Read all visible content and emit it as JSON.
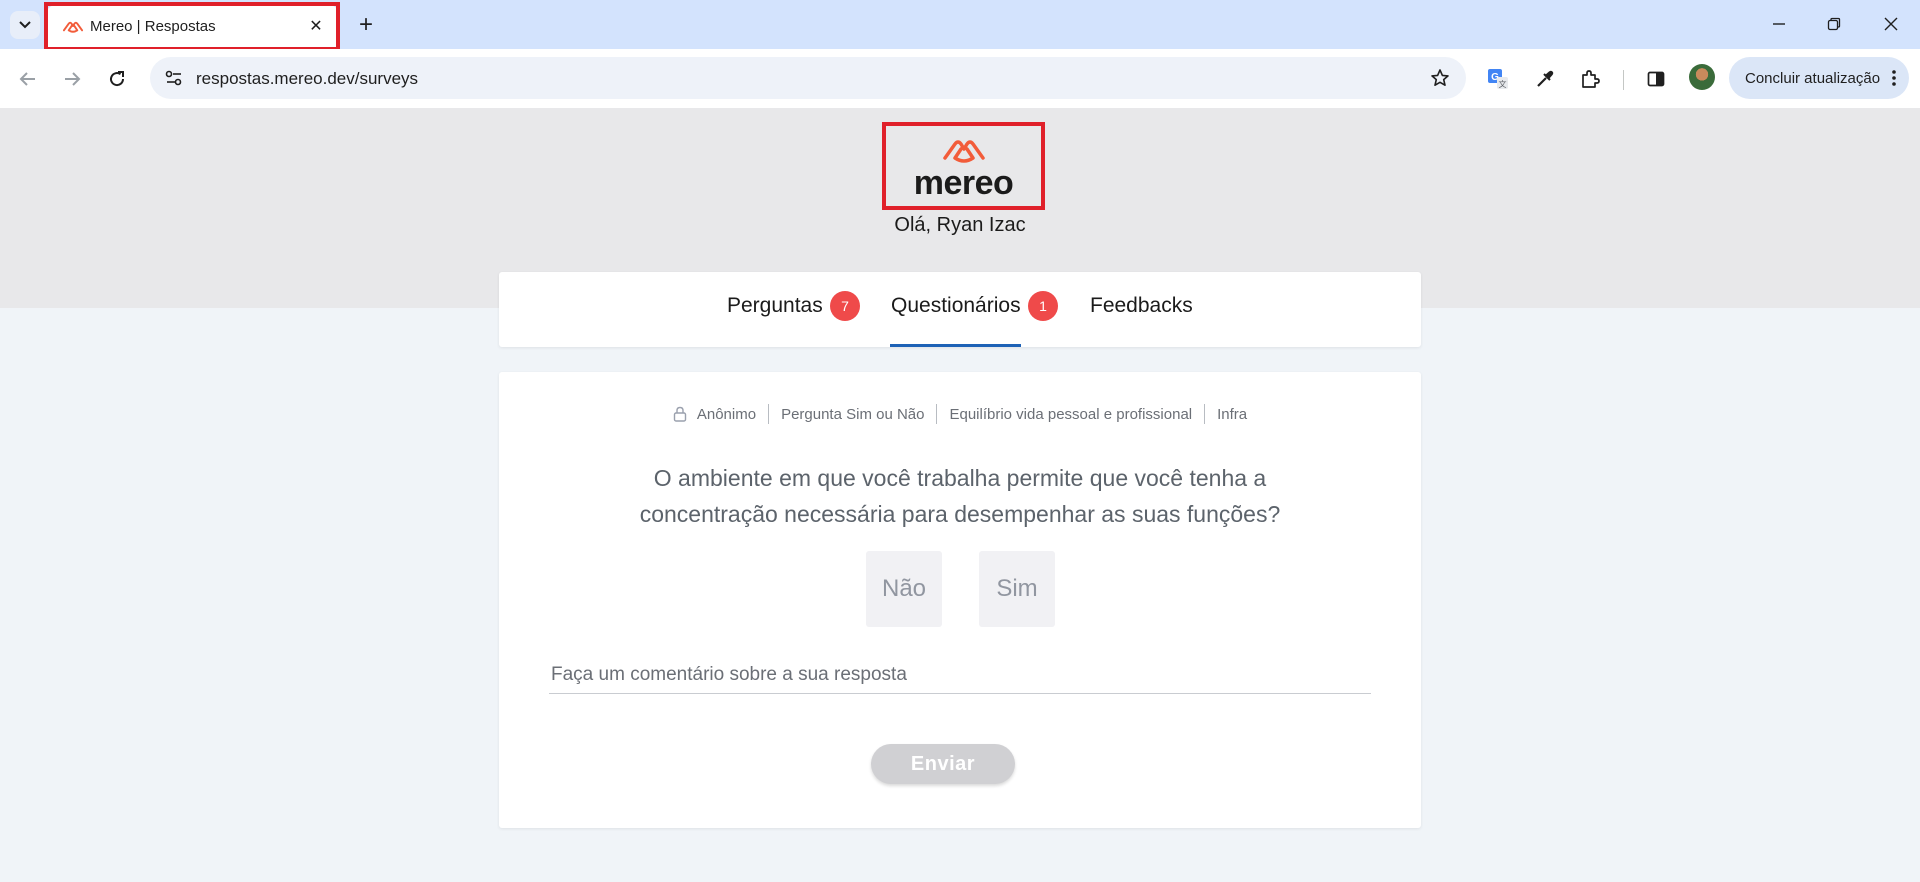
{
  "browser": {
    "tab": {
      "title": "Mereo | Respostas",
      "close": "✕"
    },
    "new_tab": "+",
    "url": "respostas.mereo.dev/surveys",
    "update_button": "Concluir atualização"
  },
  "header": {
    "logo_text": "mereo",
    "greeting": "Olá, Ryan Izac"
  },
  "nav_tabs": [
    {
      "label": "Perguntas",
      "badge": "7"
    },
    {
      "label": "Questionários",
      "badge": "1",
      "active": true
    },
    {
      "label": "Feedbacks"
    }
  ],
  "survey": {
    "meta": [
      "Anônimo",
      "Pergunta Sim ou Não",
      "Equilíbrio vida pessoal e profissional",
      "Infra"
    ],
    "question": "O ambiente em que você trabalha permite que você tenha a concentração necessária para desempenhar as suas funções?",
    "options": [
      "Não",
      "Sim"
    ],
    "comment_placeholder": "Faça um comentário sobre a sua resposta",
    "submit_label": "Enviar"
  },
  "colors": {
    "brand": "#f25c3a",
    "badge": "#ef4a4a",
    "active_tab": "#1e62b6",
    "highlight": "#e0202a"
  }
}
